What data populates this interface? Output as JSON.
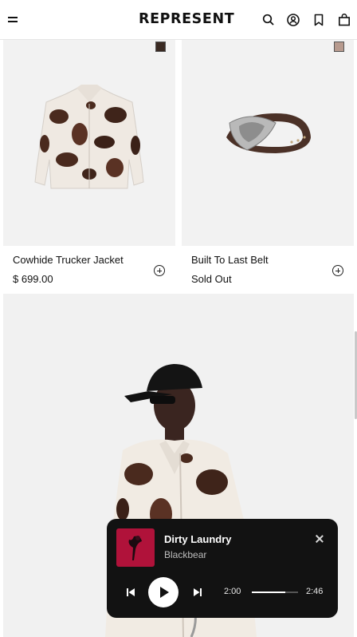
{
  "header": {
    "logo": "REPRESENT",
    "icons": [
      "menu-icon",
      "search-icon",
      "account-icon",
      "bookmark-icon",
      "bag-icon"
    ]
  },
  "products": [
    {
      "name": "Cowhide Trucker Jacket",
      "price": "$ 699.00",
      "swatch_color": "#3a2a22"
    },
    {
      "name": "Built To Last Belt",
      "price": "Sold Out",
      "swatch_color": "#b79a8e"
    }
  ],
  "colors": {
    "player_bg": "#121212",
    "cover_bg": "#b0123a"
  },
  "player": {
    "title": "Dirty Laundry",
    "artist": "Blackbear",
    "current_time": "2:00",
    "total_time": "2:46",
    "progress_fraction": 0.72
  }
}
